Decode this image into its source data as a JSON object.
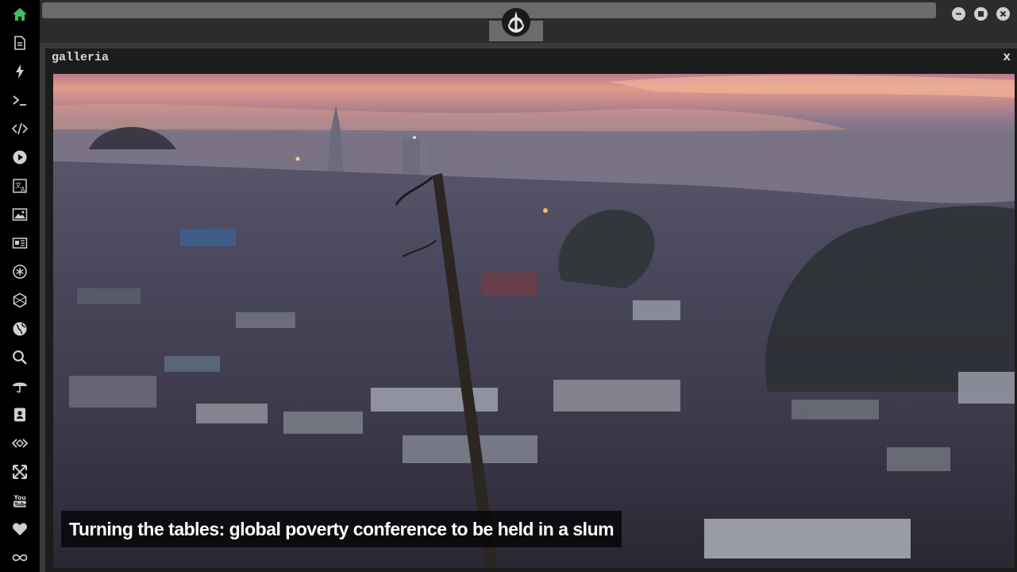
{
  "sidebar": {
    "items": [
      {
        "icon": "home-icon"
      },
      {
        "icon": "document-icon"
      },
      {
        "icon": "lightning-icon"
      },
      {
        "icon": "terminal-icon"
      },
      {
        "icon": "code-icon"
      },
      {
        "icon": "play-icon"
      },
      {
        "icon": "translate-icon"
      },
      {
        "icon": "image-icon"
      },
      {
        "icon": "newspaper-icon"
      },
      {
        "icon": "openai-icon"
      },
      {
        "icon": "hexagon-icon"
      },
      {
        "icon": "globe-icon"
      },
      {
        "icon": "search-icon"
      },
      {
        "icon": "umbrella-icon"
      },
      {
        "icon": "contact-card-icon"
      },
      {
        "icon": "embed-icon"
      },
      {
        "icon": "expand-icon"
      },
      {
        "icon": "youtube-icon"
      },
      {
        "icon": "heart-icon"
      },
      {
        "icon": "infinity-icon"
      }
    ],
    "active_color": "#3fbf5f",
    "icon_color": "#d0d0d0"
  },
  "topbar": {
    "logo_icon": "rebel-alliance-icon"
  },
  "panel": {
    "title": "galleria",
    "close_label": "x"
  },
  "gallery": {
    "caption": "Turning the tables: global poverty conference to be held in a slum"
  }
}
